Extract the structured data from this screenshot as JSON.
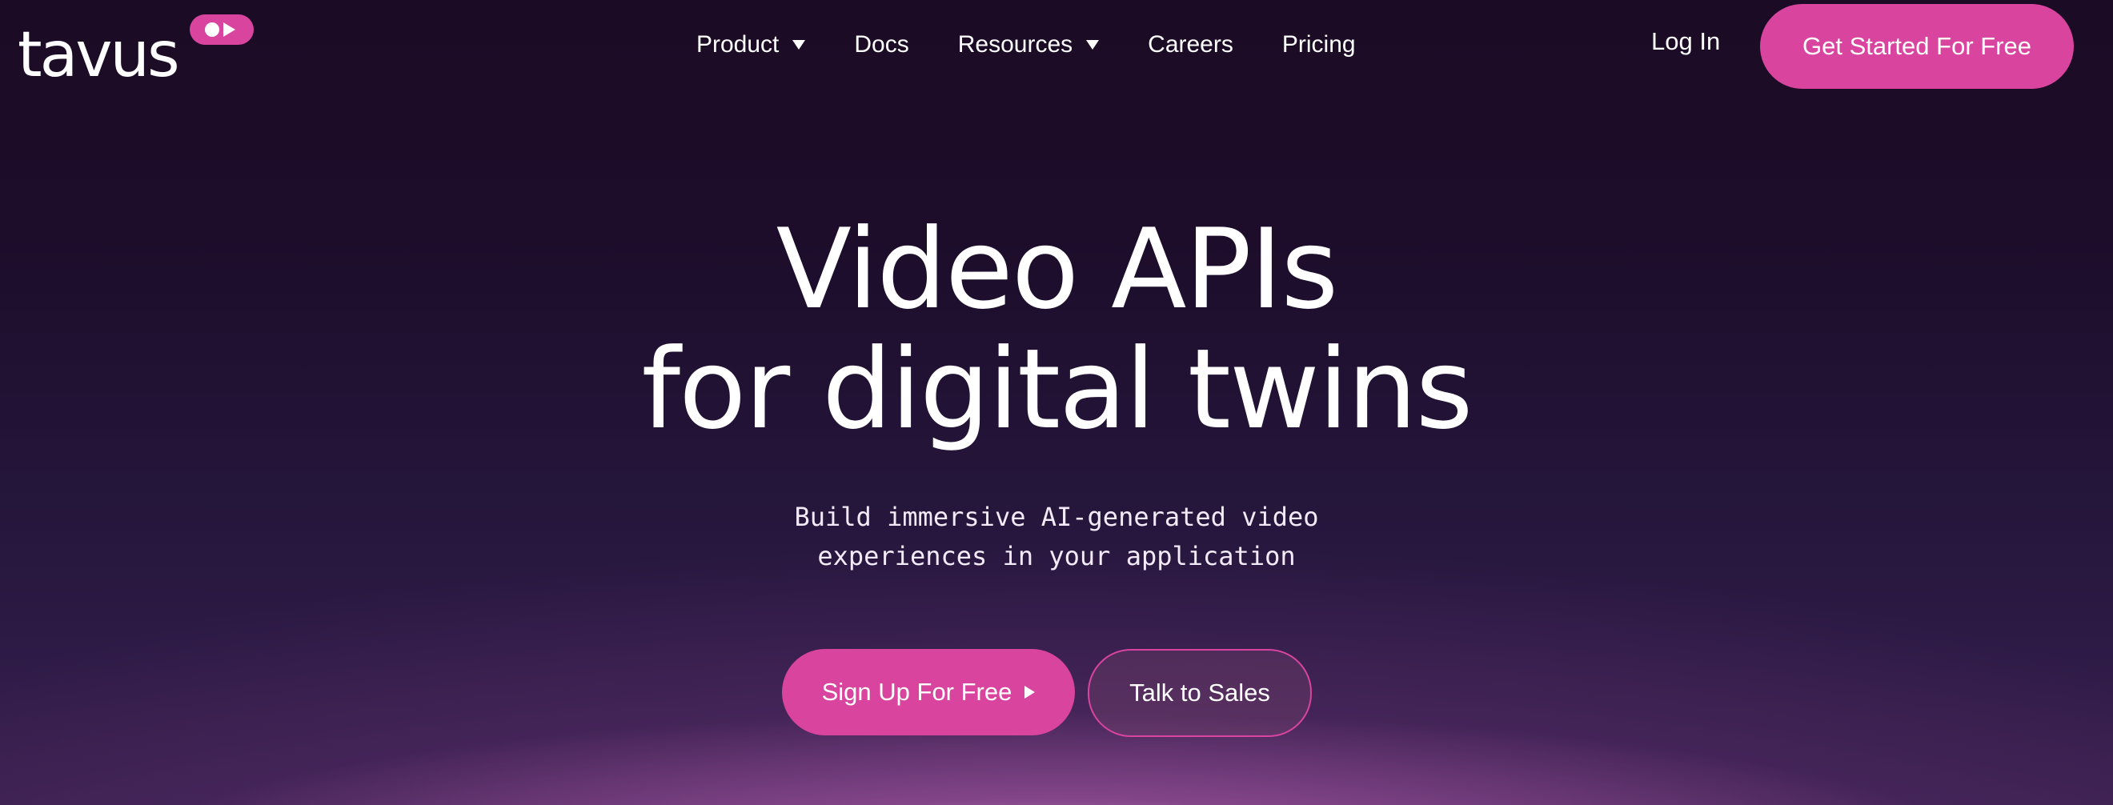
{
  "brand": {
    "logo_text": "tavus",
    "accent_color": "#d9449f"
  },
  "nav": {
    "items": [
      {
        "label": "Product",
        "has_dropdown": true
      },
      {
        "label": "Docs",
        "has_dropdown": false
      },
      {
        "label": "Resources",
        "has_dropdown": true
      },
      {
        "label": "Careers",
        "has_dropdown": false
      },
      {
        "label": "Pricing",
        "has_dropdown": false
      }
    ],
    "login_label": "Log In",
    "cta_label": "Get Started For Free"
  },
  "hero": {
    "title_line1": "Video APIs",
    "title_line2": "for digital twins",
    "subtitle_line1": "Build immersive AI-generated video",
    "subtitle_line2": "experiences in your application",
    "primary_button": "Sign Up For Free",
    "secondary_button": "Talk to Sales"
  },
  "icons": {
    "logo_badge": "record-play-icon",
    "dropdown": "caret-down-icon",
    "primary_button": "play-arrow-icon"
  },
  "colors": {
    "background_top": "#1c0b24",
    "background_bottom_glow": "#d68cc8",
    "text": "#ffffff"
  }
}
